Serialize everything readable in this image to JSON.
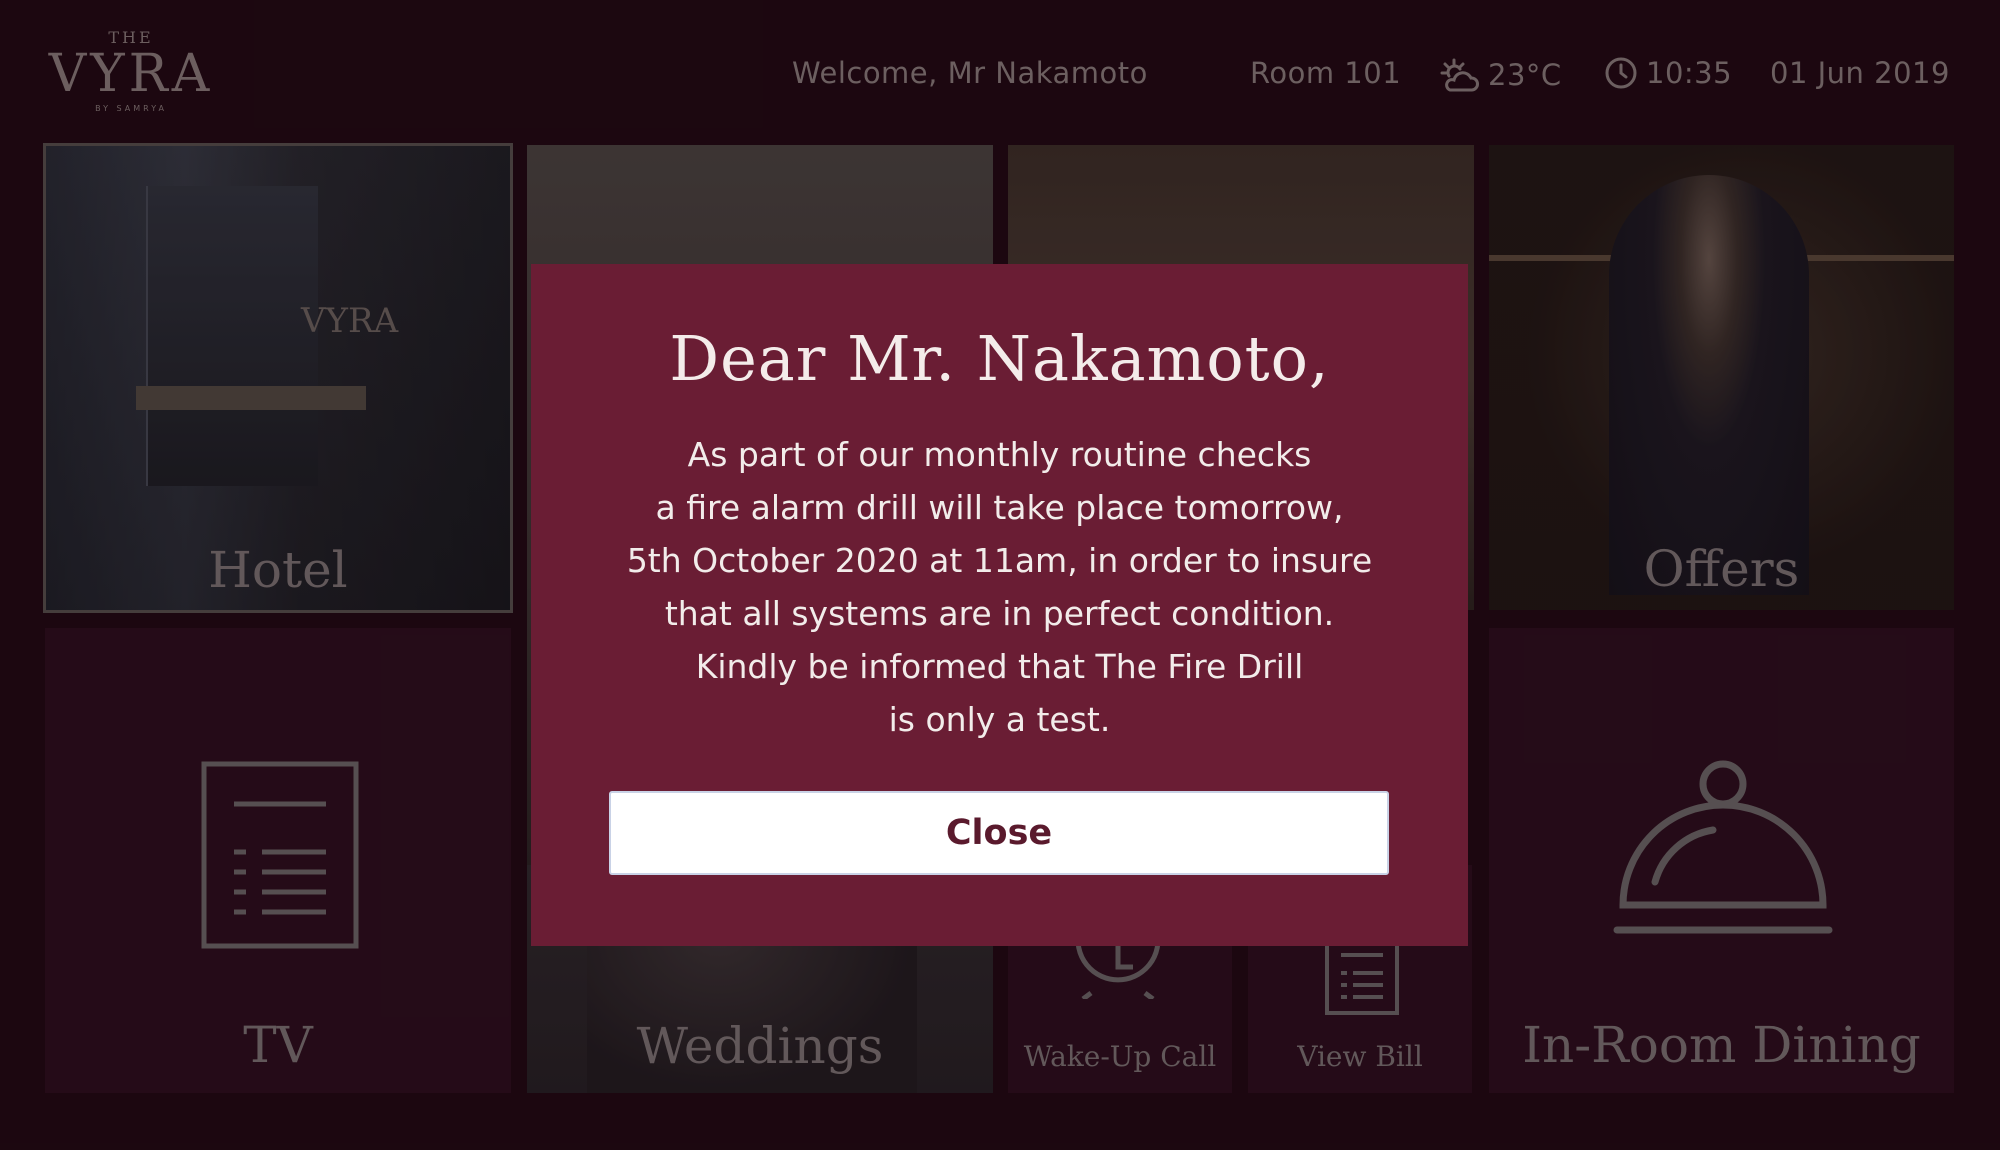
{
  "brand": {
    "the": "THE",
    "name": "VYRA",
    "by": "BY SAMRYA"
  },
  "header": {
    "welcome": "Welcome, Mr Nakamoto",
    "room": "Room 101",
    "temperature": "23°C",
    "time": "10:35",
    "date": "01 Jun 2019",
    "weather_icon": "partly-cloudy-icon",
    "clock_icon": "clock-icon"
  },
  "tiles": {
    "hotel": "Hotel",
    "offers": "Offers",
    "tv": "TV",
    "weddings": "Weddings",
    "wake_up_call": "Wake-Up Call",
    "view_bill": "View Bill",
    "in_room_dining": "In-Room Dining",
    "hotel_sign": "VYRA"
  },
  "modal": {
    "title": "Dear Mr. Nakamoto,",
    "body_lines": [
      "As part of our monthly routine checks",
      "a fire alarm drill will take place tomorrow,",
      "5th October 2020 at 11am, in order to insure",
      "that all systems are in perfect condition.",
      "Kindly be informed that The Fire Drill",
      "is only a test."
    ],
    "close_label": "Close"
  },
  "colors": {
    "background": "#1f0912",
    "modal": "#6a1d34",
    "tile": "#2b0e1c",
    "button_text": "#5a1a2d"
  }
}
